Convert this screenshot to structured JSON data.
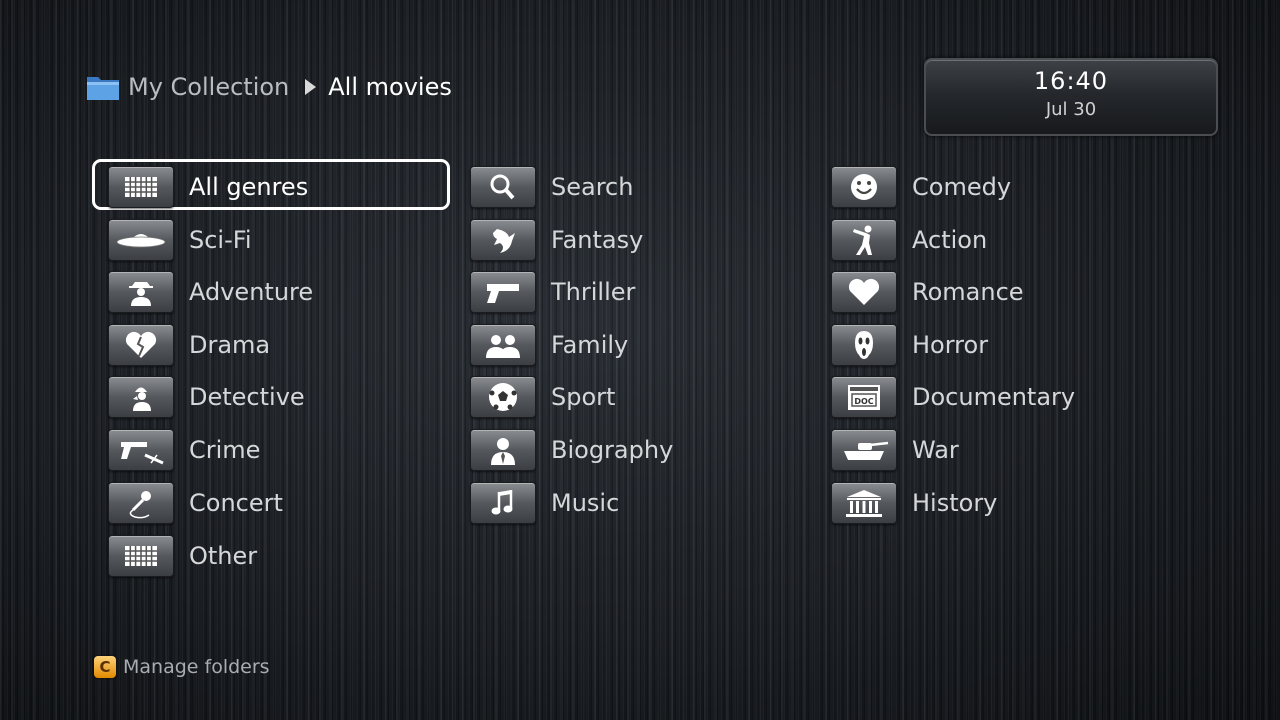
{
  "breadcrumb": {
    "root": "My Collection",
    "current": "All movies",
    "folder_icon": "folder-icon",
    "folder_color": "#4a90d9"
  },
  "clock": {
    "time": "16:40",
    "date": "Jul 30"
  },
  "genres": {
    "selected": "All genres",
    "columns": [
      [
        {
          "label": "All genres",
          "icon": "grid-icon"
        },
        {
          "label": "Sci-Fi",
          "icon": "ufo-icon"
        },
        {
          "label": "Adventure",
          "icon": "adventurer-icon"
        },
        {
          "label": "Drama",
          "icon": "broken-heart-icon"
        },
        {
          "label": "Detective",
          "icon": "detective-icon"
        },
        {
          "label": "Crime",
          "icon": "gun-syringe-icon"
        },
        {
          "label": "Concert",
          "icon": "microphone-icon"
        },
        {
          "label": "Other",
          "icon": "grid-icon"
        }
      ],
      [
        {
          "label": "Search",
          "icon": "magnifier-icon"
        },
        {
          "label": "Fantasy",
          "icon": "dragon-icon"
        },
        {
          "label": "Thriller",
          "icon": "pistol-icon"
        },
        {
          "label": "Family",
          "icon": "family-icon"
        },
        {
          "label": "Sport",
          "icon": "soccer-ball-icon"
        },
        {
          "label": "Biography",
          "icon": "person-icon"
        },
        {
          "label": "Music",
          "icon": "music-note-icon"
        }
      ],
      [
        {
          "label": "Comedy",
          "icon": "smiley-icon"
        },
        {
          "label": "Action",
          "icon": "kick-icon"
        },
        {
          "label": "Romance",
          "icon": "heart-icon"
        },
        {
          "label": "Horror",
          "icon": "scream-mask-icon"
        },
        {
          "label": "Documentary",
          "icon": "doc-icon"
        },
        {
          "label": "War",
          "icon": "tank-icon"
        },
        {
          "label": "History",
          "icon": "museum-icon"
        }
      ]
    ]
  },
  "footer": {
    "key": "C",
    "key_color": "#f0a020",
    "label": "Manage folders"
  }
}
